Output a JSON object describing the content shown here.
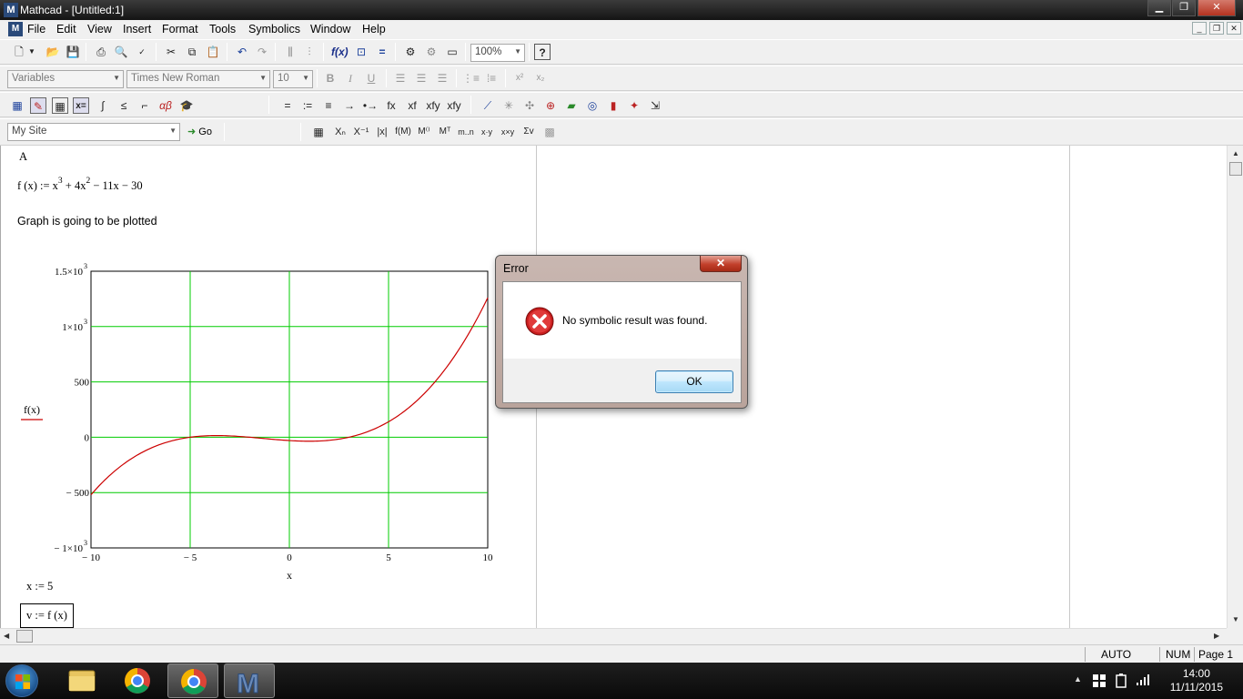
{
  "window": {
    "title": "Mathcad - [Untitled:1]",
    "min": "▁",
    "max": "❐",
    "close": "✕"
  },
  "menu": [
    "File",
    "Edit",
    "View",
    "Insert",
    "Format",
    "Tools",
    "Symbolics",
    "Window",
    "Help"
  ],
  "toolbar": {
    "zoom": "100%",
    "style": "Variables",
    "font": "Times New Roman",
    "size": "10",
    "site": "My Site",
    "go": "Go",
    "bold": "B",
    "italic": "I",
    "underline": "U"
  },
  "worksheet": {
    "label_a": "A",
    "def_lhs": "f (x) := x",
    "def_exp1": "3",
    "def_mid": " + 4x",
    "def_exp2": "2",
    "def_rest": " − 11x − 30",
    "text": "Graph is going to be plotted",
    "assign_x": "x := 5",
    "assign_v": "v := f (x)"
  },
  "chart_data": {
    "type": "line",
    "function": "f(x) = x^3 + 4x^2 - 11x - 30",
    "x": [
      -10,
      -9,
      -8,
      -7,
      -6,
      -5,
      -4,
      -3,
      -2,
      -1,
      0,
      1,
      2,
      3,
      4,
      5,
      6,
      7,
      8,
      9,
      10
    ],
    "series": [
      {
        "values": [
          -520,
          -336,
          -198,
          -100,
          -36,
          0,
          14,
          12,
          0,
          -16,
          -30,
          -36,
          -28,
          0,
          54,
          140,
          264,
          432,
          650,
          924,
          1260
        ]
      }
    ],
    "xlabel": "x",
    "ylabel": "f(x)",
    "xlim": [
      -10,
      10
    ],
    "ylim": [
      -1000,
      1500
    ],
    "x_ticks": [
      "− 10",
      "− 5",
      "0",
      "5",
      "10"
    ],
    "y_ticks": [
      "1.5×10",
      "1×10",
      "500",
      "0",
      "− 500",
      "− 1×10"
    ],
    "y_tick_exp": "3",
    "grid": true,
    "line_color": "#cc0000",
    "grid_color": "#00cc00"
  },
  "dialog": {
    "title": "Error",
    "message": "No symbolic result was found.",
    "ok": "OK",
    "close": "✕"
  },
  "status": {
    "mode": "AUTO",
    "num": "NUM",
    "page": "Page 1"
  },
  "taskbar": {
    "time": "14:00",
    "date": "11/11/2015"
  }
}
